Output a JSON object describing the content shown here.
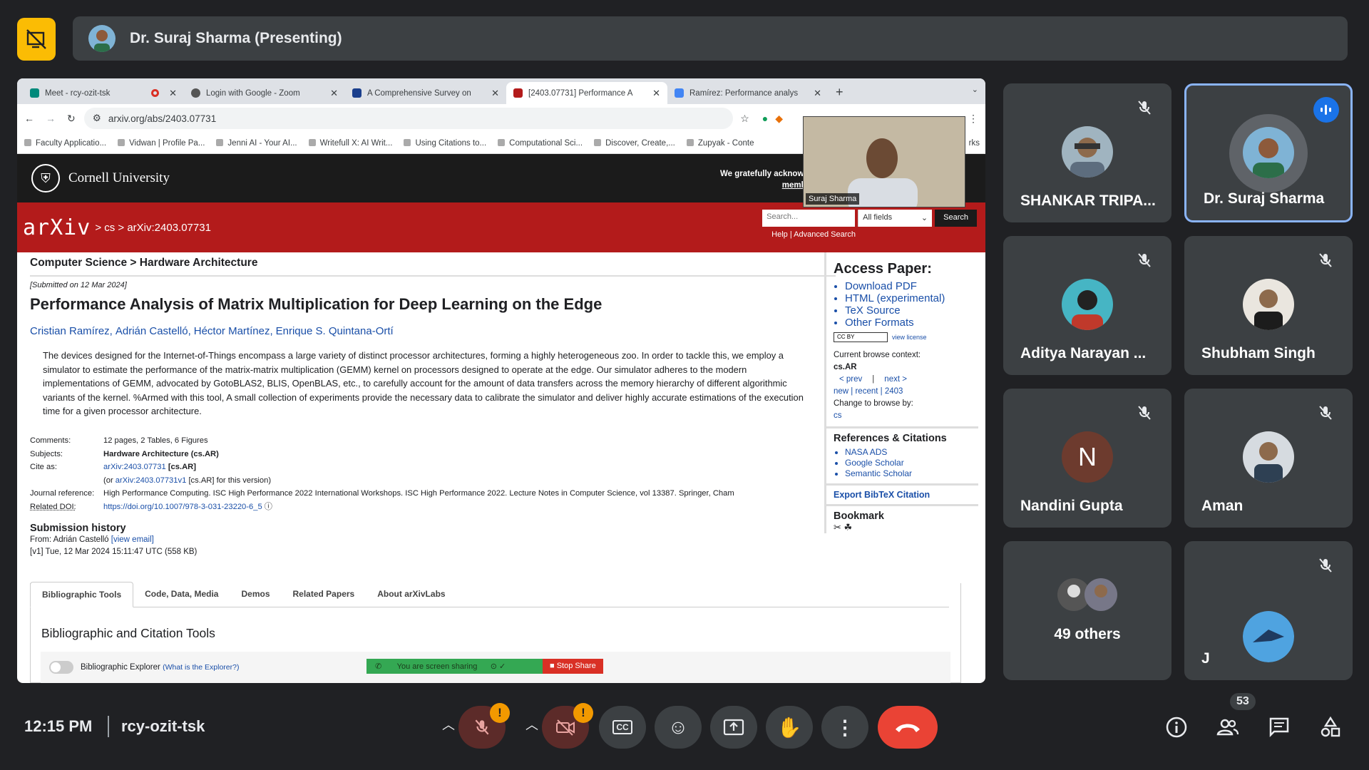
{
  "meeting": {
    "presenter": "Dr. Suraj Sharma (Presenting)",
    "time": "12:15 PM",
    "code": "rcy-ozit-tsk",
    "participant_count": "53"
  },
  "browser": {
    "tabs": [
      {
        "title": "Meet - rcy-ozit-tsk"
      },
      {
        "title": "Login with Google - Zoom"
      },
      {
        "title": "A Comprehensive Survey on"
      },
      {
        "title": "[2403.07731] Performance A"
      },
      {
        "title": "Ramírez: Performance analys"
      }
    ],
    "url": "arxiv.org/abs/2403.07731",
    "bookmarks": [
      "Faculty Applicatio...",
      "Vidwan | Profile Pa...",
      "Jenni AI - Your AI...",
      "Writefull X: AI Writ...",
      "Using Citations to...",
      "Computational Sci...",
      "Discover, Create,...",
      "Zupyak - Conte"
    ],
    "bookmarks_end": "rks"
  },
  "arxiv": {
    "institution": "Cornell University",
    "ack_line1": "We gratefully acknowle",
    "ack_line2": "membe",
    "logo": "arXiv",
    "breadcrumb": "> cs > arXiv:2403.07731",
    "search_placeholder": "Search...",
    "search_field": "All fields",
    "search_button": "Search",
    "search_links": "Help | Advanced Search",
    "category": "Computer Science > Hardware Architecture",
    "submitted": "[Submitted on 12 Mar 2024]",
    "title": "Performance Analysis of Matrix Multiplication for Deep Learning on the Edge",
    "authors": [
      "Cristian Ramírez,",
      "Adrián Castelló,",
      "Héctor Martínez,",
      "Enrique S. Quintana-Ortí"
    ],
    "abstract": "The devices designed for the Internet-of-Things encompass a large variety of distinct processor architectures, forming a highly heterogeneous zoo. In order to tackle this, we employ a simulator to estimate the performance of the matrix-matrix multiplication (GEMM) kernel on processors designed to operate at the edge. Our simulator adheres to the modern implementations of GEMM, advocated by GotoBLAS2, BLIS, OpenBLAS, etc., to carefully account for the amount of data transfers across the memory hierarchy of different algorithmic variants of the kernel. %Armed with this tool, A small collection of experiments provide the necessary data to calibrate the simulator and deliver highly accurate estimations of the execution time for a given processor architecture.",
    "meta": {
      "comments_k": "Comments:",
      "comments_v": "12 pages, 2 Tables, 6 Figures",
      "subjects_k": "Subjects:",
      "subjects_v": "Hardware Architecture (cs.AR)",
      "cite_k": "Cite as:",
      "cite_v": "arXiv:2403.07731",
      "cite_tag": "[cs.AR]",
      "cite2_pre": "(or",
      "cite2_v": "arXiv:2403.07731v1",
      "cite2_post": "[cs.AR] for this version)",
      "journal_k": "Journal reference:",
      "journal_v": "High Performance Computing. ISC High Performance 2022 International Workshops. ISC High Performance 2022. Lecture Notes in Computer Science, vol 13387. Springer, Cham",
      "doi_k": "Related DOI:",
      "doi_v": "https://doi.org/10.1007/978-3-031-23220-6_5"
    },
    "history_title": "Submission history",
    "history_from": "From: Adrián Castelló",
    "history_view": "[view email]",
    "history_v1": "[v1] Tue, 12 Mar 2024 15:11:47 UTC (558 KB)",
    "lab_tabs": [
      "Bibliographic Tools",
      "Code, Data, Media",
      "Demos",
      "Related Papers",
      "About arXivLabs"
    ],
    "bib_heading": "Bibliographic and Citation Tools",
    "bib_explorer": "Bibliographic Explorer",
    "bib_explorer_link": "(What is the Explorer?)",
    "aside": {
      "access_title": "Access Paper:",
      "access_links": [
        "Download PDF",
        "HTML (experimental)",
        "TeX Source",
        "Other Formats"
      ],
      "license_badge": "CC BY",
      "license_link": "view license",
      "browse_context": "Current browse context:",
      "context_value": "cs.AR",
      "prev": "< prev",
      "next": "next >",
      "new_recent": "new | recent | 2403",
      "change_browse": "Change to browse by:",
      "browse_cs": "cs",
      "refs_title": "References & Citations",
      "refs": [
        "NASA ADS",
        "Google Scholar",
        "Semantic Scholar"
      ],
      "bibtex": "Export BibTeX Citation",
      "bookmark": "Bookmark"
    },
    "share_banner": "You are screen sharing",
    "stop_share": "Stop Share"
  },
  "pip_name": "Suraj Sharma",
  "participants": [
    {
      "name": "SHANKAR TRIPA...",
      "muted": true
    },
    {
      "name": "Dr. Suraj Sharma",
      "muted": false,
      "speaking": true
    },
    {
      "name": "Aditya Narayan ...",
      "muted": true
    },
    {
      "name": "Shubham Singh",
      "muted": true
    },
    {
      "name": "Nandini Gupta",
      "initial": "N",
      "muted": true
    },
    {
      "name": "Aman",
      "muted": true
    },
    {
      "name": "49 others"
    },
    {
      "name": "J",
      "muted": true
    }
  ],
  "colors": {
    "arxiv_red": "#b31b1b",
    "meet_bg": "#202124",
    "tile": "#3c4043",
    "end_call": "#ea4335",
    "accent": "#8ab4f8"
  }
}
